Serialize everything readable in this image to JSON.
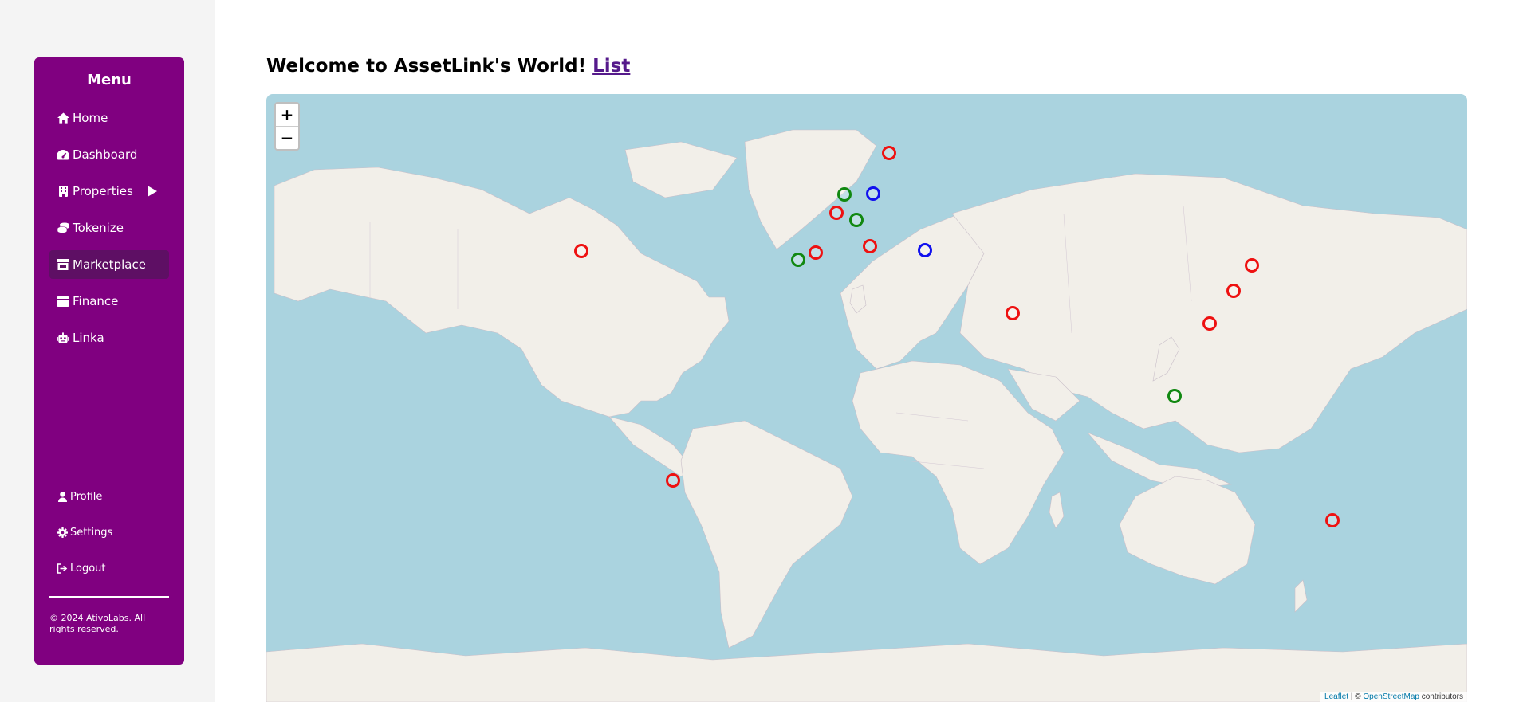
{
  "sidebar": {
    "title": "Menu",
    "items": [
      {
        "label": "Home",
        "icon": "home-icon"
      },
      {
        "label": "Dashboard",
        "icon": "gauge-icon"
      },
      {
        "label": "Properties",
        "icon": "building-icon"
      },
      {
        "label": "Tokenize",
        "icon": "coins-icon"
      },
      {
        "label": "Marketplace",
        "icon": "store-icon"
      },
      {
        "label": "Finance",
        "icon": "wallet-icon"
      },
      {
        "label": "Linka",
        "icon": "robot-icon"
      }
    ],
    "active": "Marketplace",
    "bottom_items": [
      {
        "label": "Profile",
        "icon": "user-icon"
      },
      {
        "label": "Settings",
        "icon": "gear-icon"
      },
      {
        "label": "Logout",
        "icon": "logout-icon"
      }
    ],
    "copyright": "© 2024 AtivoLabs. All rights reserved."
  },
  "header": {
    "title": "Welcome to AssetLink's World!",
    "link": "List"
  },
  "map": {
    "zoom_in": "+",
    "zoom_out": "−",
    "attribution_leaflet": "Leaflet",
    "attribution_sep": " | © ",
    "attribution_osm": "OpenStreetMap",
    "attribution_suffix": " contributors",
    "marker_colors": {
      "red": "#ee1111",
      "green": "#118811",
      "blue": "#1111ee"
    },
    "markers": [
      {
        "lat": 59.3,
        "lng": 18.1,
        "color": "red"
      },
      {
        "lat": 52.4,
        "lng": 4.9,
        "color": "green"
      },
      {
        "lat": 52.5,
        "lng": 13.4,
        "color": "blue"
      },
      {
        "lat": 48.9,
        "lng": 2.3,
        "color": "red"
      },
      {
        "lat": 47.4,
        "lng": 8.5,
        "color": "green"
      },
      {
        "lat": 41.9,
        "lng": 12.5,
        "color": "red"
      },
      {
        "lat": 40.4,
        "lng": -3.7,
        "color": "red"
      },
      {
        "lat": 38.7,
        "lng": -9.1,
        "color": "green"
      },
      {
        "lat": 41.0,
        "lng": 29.0,
        "color": "blue"
      },
      {
        "lat": 40.7,
        "lng": -74.0,
        "color": "red"
      },
      {
        "lat": 25.2,
        "lng": 55.3,
        "color": "red"
      },
      {
        "lat": 37.5,
        "lng": 127.0,
        "color": "red"
      },
      {
        "lat": 31.2,
        "lng": 121.5,
        "color": "red"
      },
      {
        "lat": 22.3,
        "lng": 114.2,
        "color": "red"
      },
      {
        "lat": 1.3,
        "lng": 103.8,
        "color": "green"
      },
      {
        "lat": -23.5,
        "lng": -46.6,
        "color": "red"
      },
      {
        "lat": -33.9,
        "lng": 151.2,
        "color": "red"
      }
    ]
  }
}
